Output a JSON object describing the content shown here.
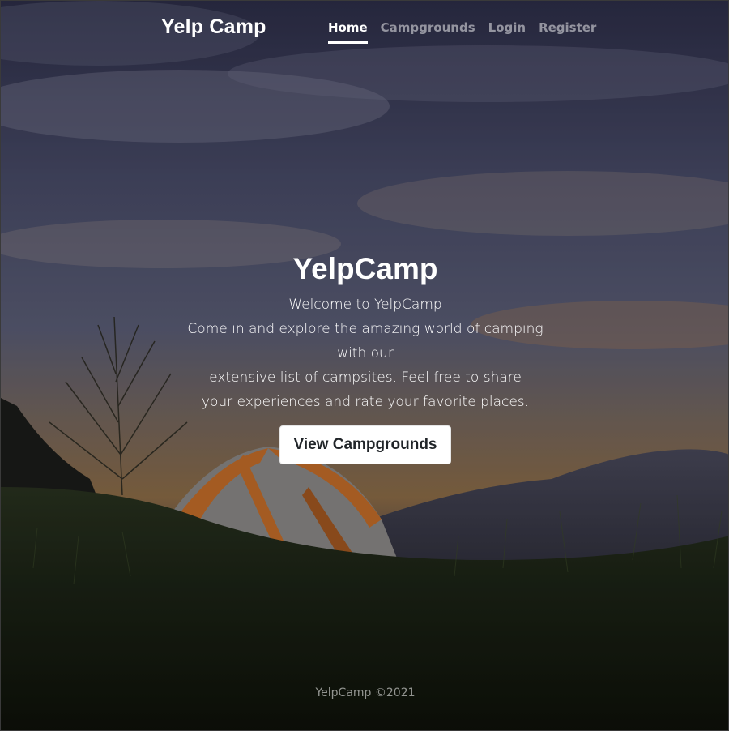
{
  "header": {
    "brand": "Yelp Camp",
    "nav": [
      {
        "label": "Home",
        "active": true
      },
      {
        "label": "Campgrounds",
        "active": false
      },
      {
        "label": "Login",
        "active": false
      },
      {
        "label": "Register",
        "active": false
      }
    ]
  },
  "hero": {
    "title": "YelpCamp",
    "lines": [
      "Welcome to YelpCamp",
      "Come in and explore the amazing world of camping with our",
      "extensive list of campsites. Feel free to share",
      "your experiences and rate your favorite places."
    ],
    "button_label": "View Campgrounds"
  },
  "footer": {
    "text": "YelpCamp ©2021"
  },
  "colors": {
    "sky_top": "#3a3e5c",
    "sky_sunset": "#b8834a",
    "grass": "#1b2414",
    "tent_orange": "#c9702a"
  }
}
